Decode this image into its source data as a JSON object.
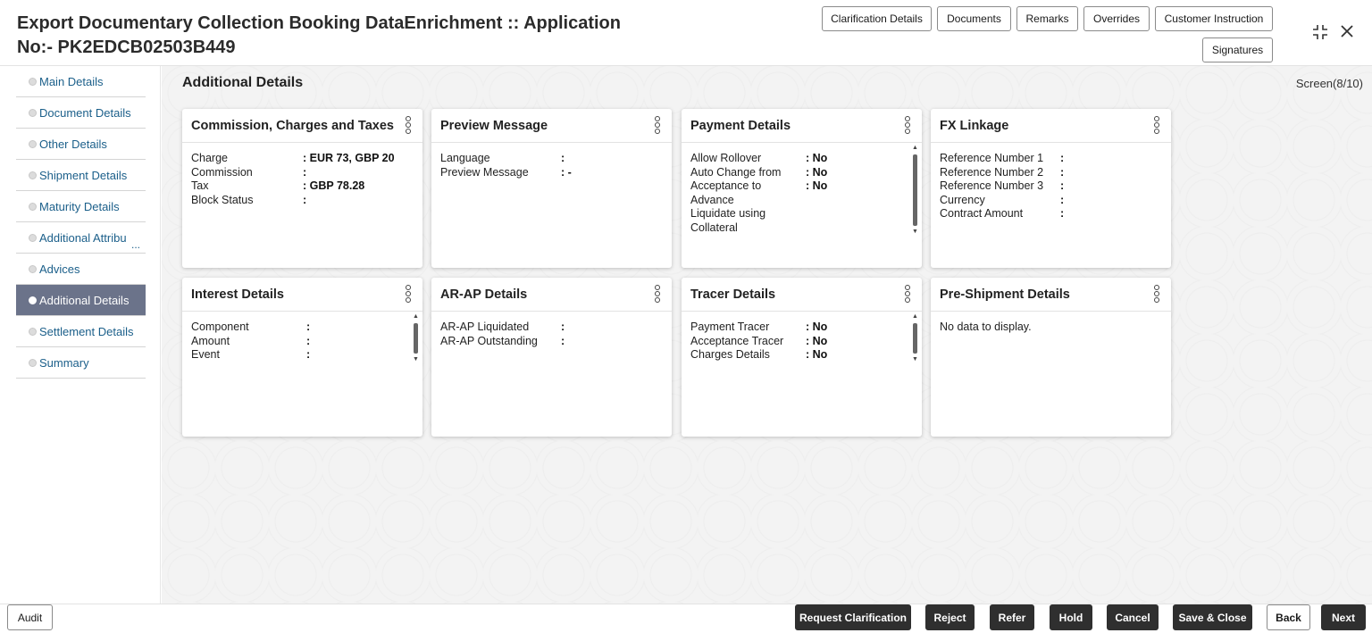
{
  "header": {
    "title": "Export Documentary Collection Booking DataEnrichment :: Application No:- PK2EDCB02503B449",
    "buttons": {
      "clarification": "Clarification Details",
      "documents": "Documents",
      "remarks": "Remarks",
      "overrides": "Overrides",
      "customer_instruction": "Customer Instruction",
      "signatures": "Signatures"
    },
    "icons": {
      "maximize": "maximize-icon",
      "close": "close-icon"
    }
  },
  "sidebar": {
    "items": [
      {
        "label": "Main Details",
        "active": false
      },
      {
        "label": "Document Details",
        "active": false
      },
      {
        "label": "Other Details",
        "active": false
      },
      {
        "label": "Shipment Details",
        "active": false
      },
      {
        "label": "Maturity Details",
        "active": false
      },
      {
        "label": "Additional Attribu",
        "active": false,
        "truncated_suffix": "..."
      },
      {
        "label": "Advices",
        "active": false
      },
      {
        "label": "Additional Details",
        "active": true
      },
      {
        "label": "Settlement Details",
        "active": false
      },
      {
        "label": "Summary",
        "active": false
      }
    ]
  },
  "main": {
    "section_title": "Additional Details",
    "screen_indicator": "Screen(8/10)",
    "cards": {
      "commission": {
        "title": "Commission, Charges and Taxes",
        "rows": [
          {
            "label": "Charge",
            "value": ": EUR 73, GBP 20"
          },
          {
            "label": "Commission",
            "value": ":"
          },
          {
            "label": "Tax",
            "value": ": GBP  78.28"
          },
          {
            "label": "Block Status",
            "value": ":"
          }
        ]
      },
      "preview": {
        "title": "Preview Message",
        "rows": [
          {
            "label": "Language",
            "value": ":"
          },
          {
            "label": "Preview Message",
            "value": ": -"
          }
        ]
      },
      "payment": {
        "title": "Payment Details",
        "rows": [
          {
            "label": "Allow Rollover",
            "value": ": No"
          },
          {
            "label": "Auto Change from",
            "value": ": No"
          },
          {
            "label": "Acceptance to Advance",
            "value": ": No"
          },
          {
            "label": "Liquidate using Collateral",
            "value": ""
          }
        ]
      },
      "fx": {
        "title": "FX Linkage",
        "rows": [
          {
            "label": "Reference Number 1",
            "value": ":"
          },
          {
            "label": "Reference Number 2",
            "value": ":"
          },
          {
            "label": "Reference Number 3",
            "value": ":"
          },
          {
            "label": "Currency",
            "value": ":"
          },
          {
            "label": "Contract Amount",
            "value": ":"
          }
        ]
      },
      "interest": {
        "title": "Interest Details",
        "rows": [
          {
            "label": "Component",
            "value": ":"
          },
          {
            "label": "Amount",
            "value": ":"
          },
          {
            "label": "Event",
            "value": ":"
          }
        ]
      },
      "arap": {
        "title": "AR-AP Details",
        "rows": [
          {
            "label": "AR-AP Liquidated",
            "value": ":"
          },
          {
            "label": "AR-AP Outstanding",
            "value": ":"
          }
        ]
      },
      "tracer": {
        "title": "Tracer Details",
        "rows": [
          {
            "label": "Payment Tracer",
            "value": ": No"
          },
          {
            "label": "Acceptance Tracer",
            "value": ": No"
          },
          {
            "label": "Charges Details",
            "value": ": No"
          }
        ]
      },
      "preshipment": {
        "title": "Pre-Shipment Details",
        "empty_text": "No data to display."
      }
    }
  },
  "footer": {
    "audit": "Audit",
    "request_clarification": "Request Clarification",
    "reject": "Reject",
    "refer": "Refer",
    "hold": "Hold",
    "cancel": "Cancel",
    "save_close": "Save & Close",
    "back": "Back",
    "next": "Next"
  },
  "colors": {
    "active_nav_bg": "#6b738a",
    "nav_link": "#1b5f8a",
    "dark_button": "#2f2f2f",
    "content_bg": "#f3f3f3"
  }
}
